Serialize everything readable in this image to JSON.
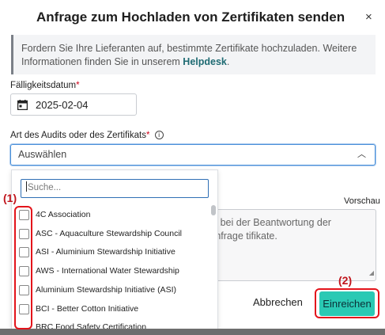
{
  "modal": {
    "title": "Anfrage zum Hochladen von Zertifikaten senden",
    "close_label": "×"
  },
  "info": {
    "text": "Fordern Sie Ihre Lieferanten auf, bestimmte Zertifikate hochzuladen. Weitere Informationen finden Sie in unserem ",
    "link_label": "Helpdesk",
    "suffix": "."
  },
  "due_date": {
    "label": "Fälligkeitsdatum",
    "required_mark": "*",
    "value": "2025-02-04"
  },
  "audit_type": {
    "label": "Art des Audits oder des Zertifikats",
    "required_mark": "*",
    "info_icon_glyph": "i",
    "placeholder": "Auswählen",
    "chevron": "︿"
  },
  "dropdown": {
    "search_placeholder": "Suche...",
    "options": [
      "4C Association",
      "ASC - Aquaculture Stewardship Council",
      "ASI - Aluminium Stewardship Initiative",
      "AWS - International Water Stewardship",
      "Aluminium Stewardship Initiative (ASI)",
      "BCI - Better Cotton Initiative",
      "BRC Food Safety Certification"
    ]
  },
  "message": {
    "preview_label": "Vorschau",
    "text": "rn bei der Beantwortung der Anfrage tifikate."
  },
  "actions": {
    "cancel_label": "Abbrechen",
    "submit_label": "Einreichen"
  },
  "annotations": {
    "label_1": "(1)",
    "label_2": "(2)",
    "color": "#e3141b"
  },
  "colors": {
    "accent": "#2ac9b4",
    "link": "#1f6b73",
    "focus": "#4a90d9"
  }
}
